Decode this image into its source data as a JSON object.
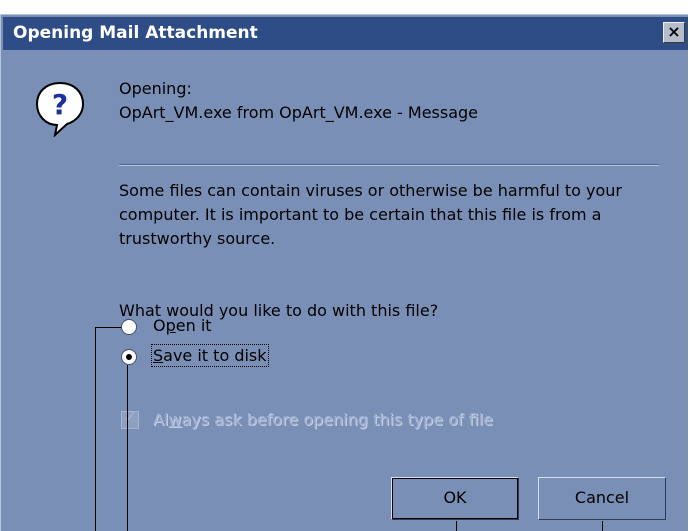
{
  "window": {
    "title": "Opening Mail Attachment",
    "close_label": "×"
  },
  "icon": "question-mark-speech-bubble-icon",
  "opening": {
    "label": "Opening:",
    "file": "OpArt_VM.exe from OpArt_VM.exe - Message"
  },
  "warning": "Some files can contain viruses or otherwise be harmful to your computer. It is important to be certain that this file is from a trustworthy source.",
  "question": "What would you like to do with this file?",
  "options": [
    {
      "pre": "O",
      "mnemonic": "p",
      "post": "en it",
      "selected": false
    },
    {
      "pre": "",
      "mnemonic": "S",
      "post": "ave it to disk",
      "selected": true
    }
  ],
  "always_ask": {
    "pre": "Al",
    "mnemonic": "w",
    "post": "ays ask before opening this type of file",
    "checked": true,
    "enabled": false
  },
  "buttons": {
    "ok": "OK",
    "cancel": "Cancel"
  },
  "colors": {
    "titlebar": "#2e4d86",
    "dialog_bg": "#7a8fb6"
  }
}
